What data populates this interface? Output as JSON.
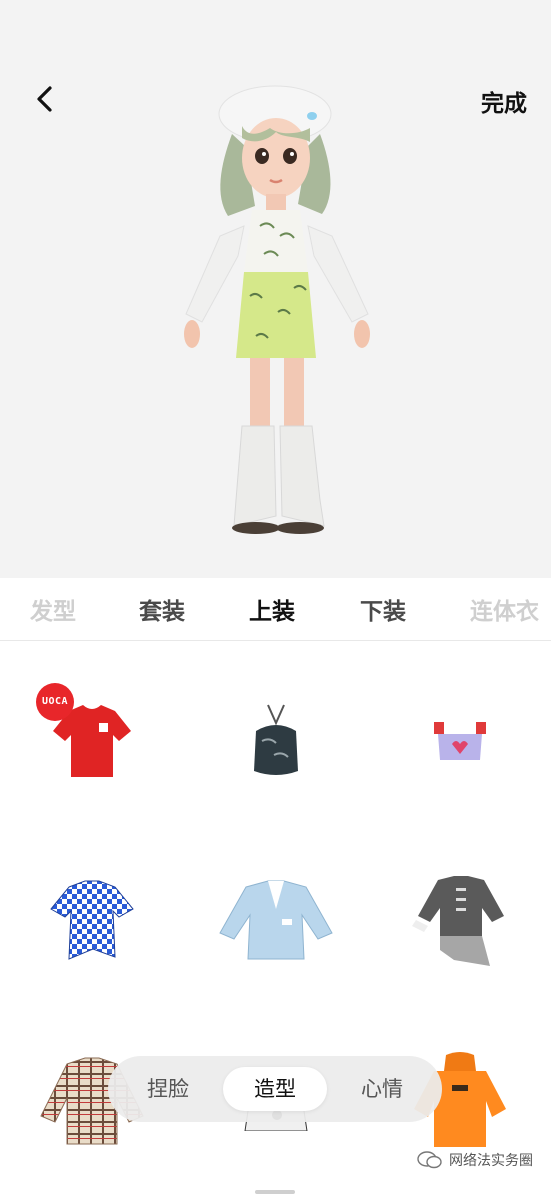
{
  "header": {
    "done_label": "完成"
  },
  "tabs": [
    {
      "label": "发型"
    },
    {
      "label": "套装"
    },
    {
      "label": "上装"
    },
    {
      "label": "下装"
    },
    {
      "label": "连体衣"
    }
  ],
  "grid": {
    "badge_text": "UOCA",
    "items": [
      {
        "name": "red-tshirt"
      },
      {
        "name": "dark-halter-top"
      },
      {
        "name": "lavender-crop-top"
      },
      {
        "name": "blue-checker-shirt"
      },
      {
        "name": "light-blue-blazer"
      },
      {
        "name": "grey-jacket-chain"
      },
      {
        "name": "plaid-shirt"
      },
      {
        "name": "panda-print-top"
      },
      {
        "name": "orange-hoodie"
      }
    ]
  },
  "bottom_nav": {
    "items": [
      {
        "label": "捏脸"
      },
      {
        "label": "造型"
      },
      {
        "label": "心情"
      }
    ]
  },
  "watermark": {
    "text": "网络法实务圈"
  },
  "colors": {
    "accent_red": "#e8262a",
    "orange": "#ff8a1f",
    "check_blue": "#2a5bd7"
  }
}
